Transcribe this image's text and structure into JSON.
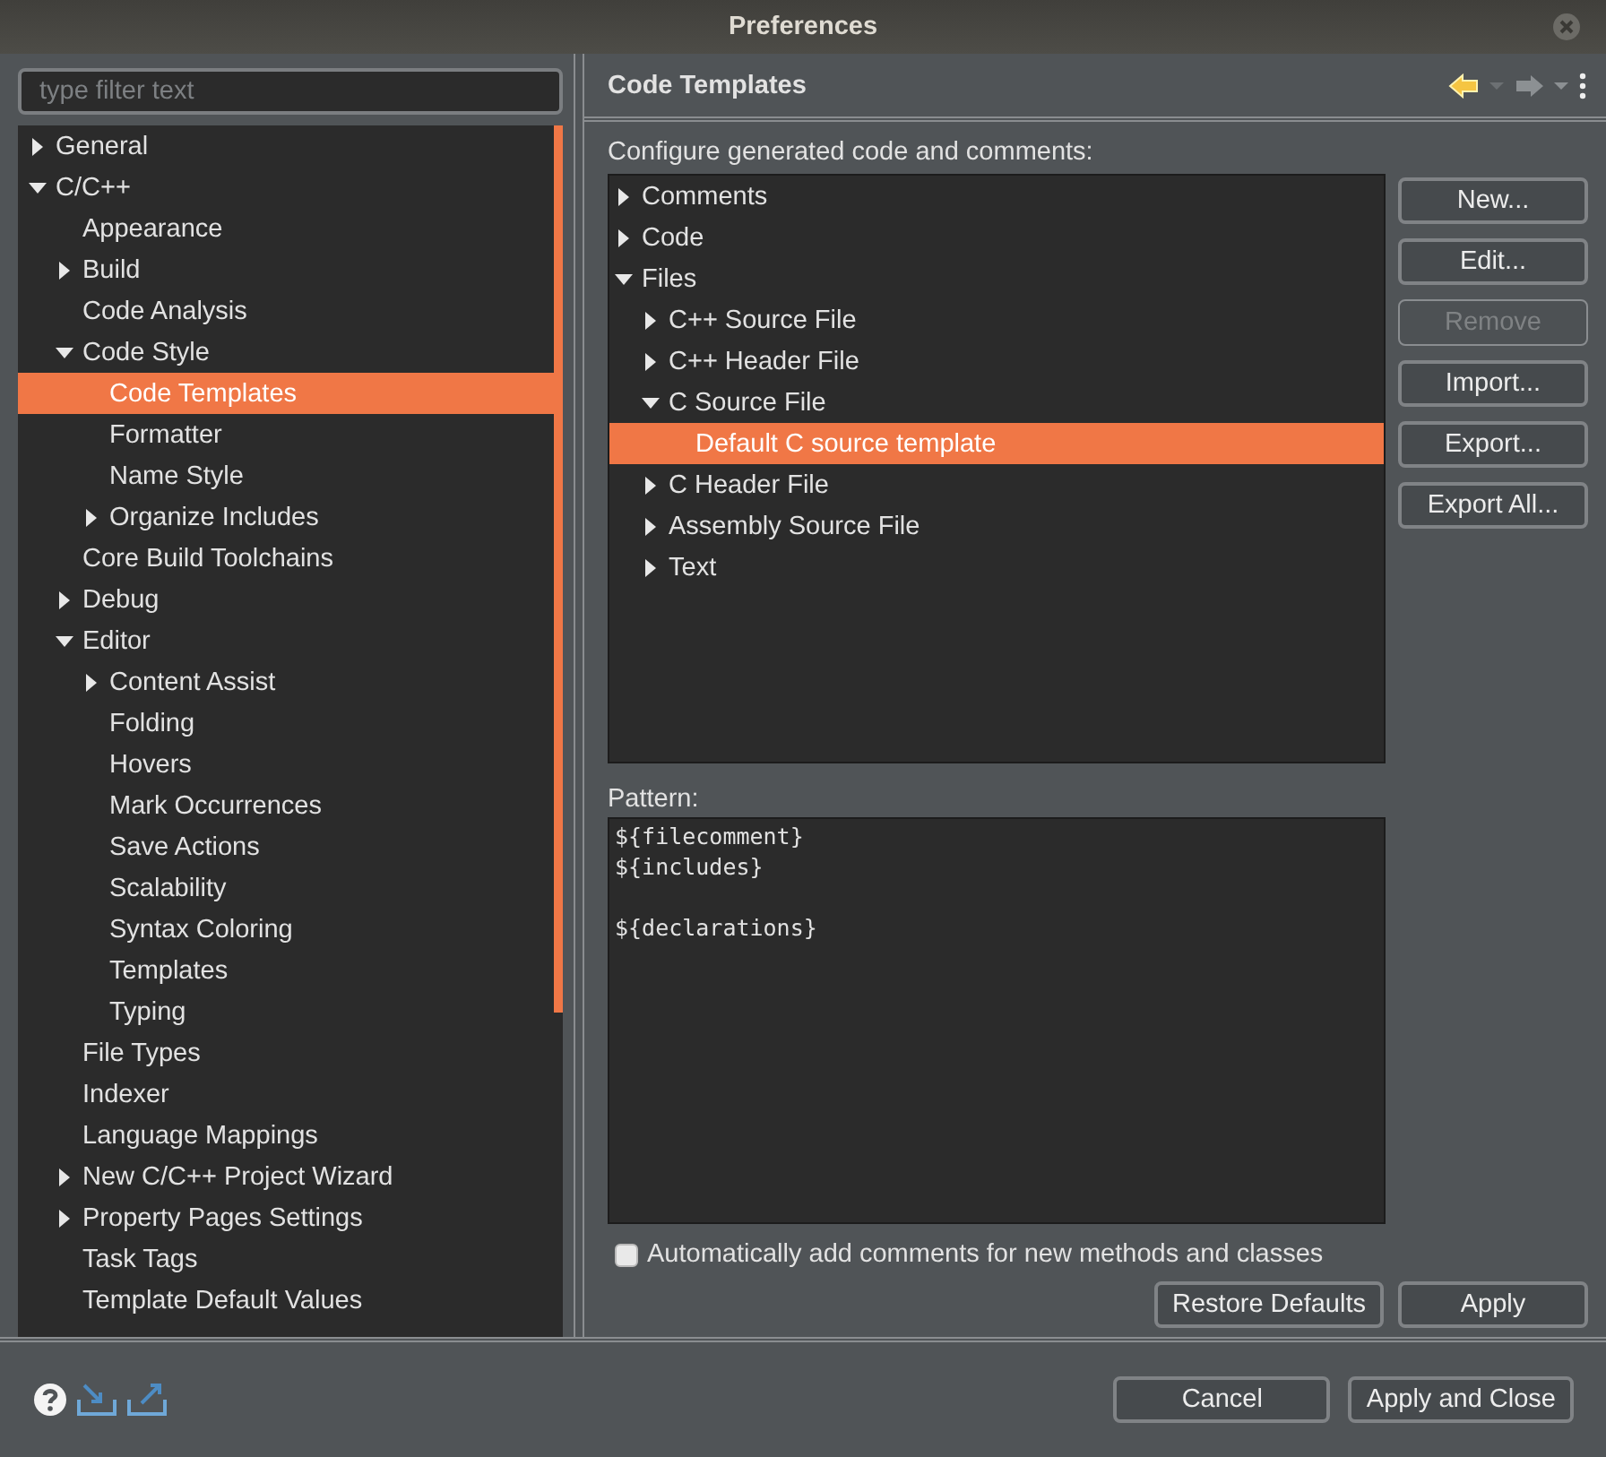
{
  "window": {
    "title": "Preferences"
  },
  "filter": {
    "placeholder": "type filter text"
  },
  "nav_tree": [
    {
      "label": "General",
      "expanded": false,
      "selected": false
    },
    {
      "label": "C/C++",
      "expanded": true,
      "selected": false,
      "children": [
        {
          "label": "Appearance",
          "selected": false
        },
        {
          "label": "Build",
          "expanded": false,
          "selected": false
        },
        {
          "label": "Code Analysis",
          "selected": false
        },
        {
          "label": "Code Style",
          "expanded": true,
          "selected": false,
          "children": [
            {
              "label": "Code Templates",
              "selected": true
            },
            {
              "label": "Formatter",
              "selected": false
            },
            {
              "label": "Name Style",
              "selected": false
            },
            {
              "label": "Organize Includes",
              "expanded": false,
              "selected": false
            }
          ]
        },
        {
          "label": "Core Build Toolchains",
          "selected": false
        },
        {
          "label": "Debug",
          "expanded": false,
          "selected": false
        },
        {
          "label": "Editor",
          "expanded": true,
          "selected": false,
          "children": [
            {
              "label": "Content Assist",
              "expanded": false,
              "selected": false
            },
            {
              "label": "Folding",
              "selected": false
            },
            {
              "label": "Hovers",
              "selected": false
            },
            {
              "label": "Mark Occurrences",
              "selected": false
            },
            {
              "label": "Save Actions",
              "selected": false
            },
            {
              "label": "Scalability",
              "selected": false
            },
            {
              "label": "Syntax Coloring",
              "selected": false
            },
            {
              "label": "Templates",
              "selected": false
            },
            {
              "label": "Typing",
              "selected": false
            }
          ]
        },
        {
          "label": "File Types",
          "selected": false
        },
        {
          "label": "Indexer",
          "selected": false
        },
        {
          "label": "Language Mappings",
          "selected": false
        },
        {
          "label": "New C/C++ Project Wizard",
          "expanded": false,
          "selected": false
        },
        {
          "label": "Property Pages Settings",
          "expanded": false,
          "selected": false
        },
        {
          "label": "Task Tags",
          "selected": false
        },
        {
          "label": "Template Default Values",
          "selected": false
        }
      ]
    }
  ],
  "page": {
    "title": "Code Templates",
    "description": "Configure generated code and comments:",
    "templates": [
      {
        "label": "Comments",
        "expanded": false,
        "selected": false
      },
      {
        "label": "Code",
        "expanded": false,
        "selected": false
      },
      {
        "label": "Files",
        "expanded": true,
        "selected": false,
        "children": [
          {
            "label": "C++ Source File",
            "expanded": false,
            "selected": false
          },
          {
            "label": "C++ Header File",
            "expanded": false,
            "selected": false
          },
          {
            "label": "C Source File",
            "expanded": true,
            "selected": false,
            "children": [
              {
                "label": "Default C source template",
                "selected": true
              }
            ]
          },
          {
            "label": "C Header File",
            "expanded": false,
            "selected": false
          },
          {
            "label": "Assembly Source File",
            "expanded": false,
            "selected": false
          },
          {
            "label": "Text",
            "expanded": false,
            "selected": false
          }
        ]
      }
    ],
    "buttons": [
      {
        "label": "New...",
        "disabled": false
      },
      {
        "label": "Edit...",
        "disabled": false
      },
      {
        "label": "Remove",
        "disabled": true
      },
      {
        "label": "Import...",
        "disabled": false
      },
      {
        "label": "Export...",
        "disabled": false
      },
      {
        "label": "Export All...",
        "disabled": false
      }
    ],
    "pattern_label": "Pattern:",
    "pattern": "${filecomment}\n${includes}\n\n${declarations}",
    "auto_comments": {
      "label": "Automatically add comments for new methods and classes",
      "checked": false
    },
    "page_buttons": [
      "Restore Defaults",
      "Apply"
    ]
  },
  "footer": {
    "buttons": [
      "Cancel",
      "Apply and Close"
    ]
  }
}
